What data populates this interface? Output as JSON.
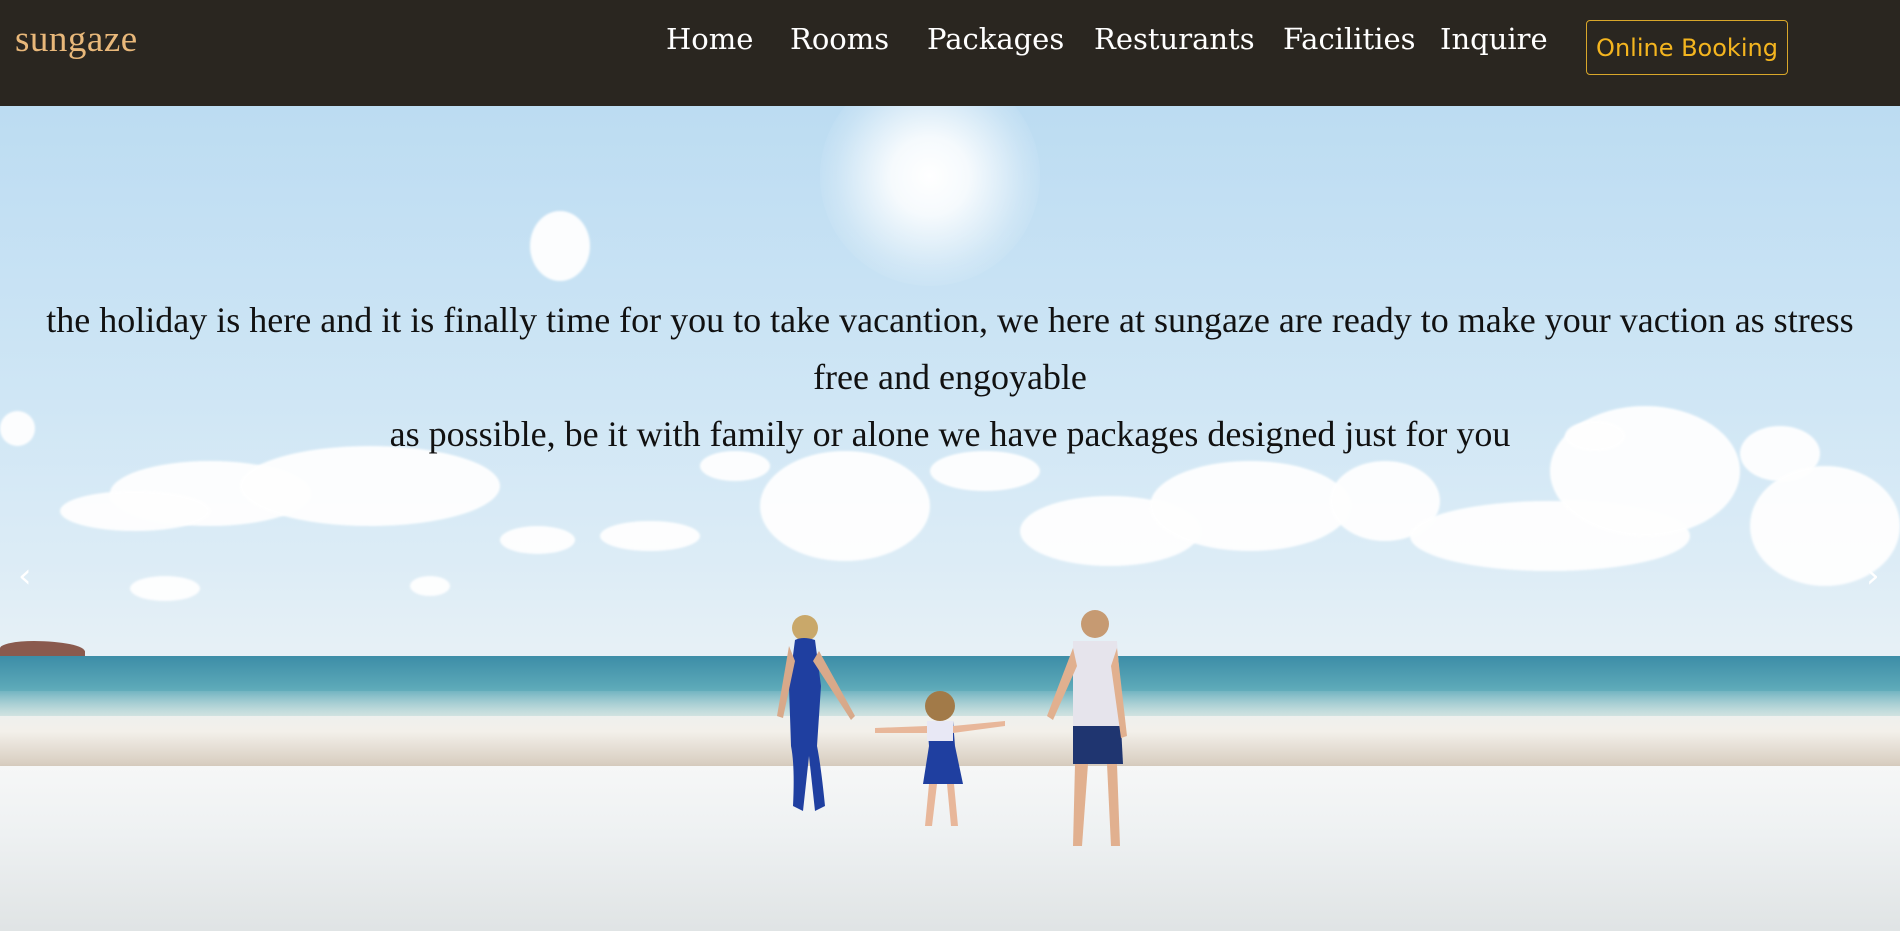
{
  "brand": {
    "name": "sungaze"
  },
  "nav": {
    "items": [
      "Home",
      "Rooms",
      "Packages",
      "Resturants",
      "Facilities",
      "Inquire"
    ],
    "booking_label": "Online Booking"
  },
  "hero": {
    "line1": "the holiday is here and it is finally time for you to take vacantion, we here at sungaze are ready to make your vaction as stress free and engoyable",
    "line2": "as possible, be it with family or alone we have packages designed just for you",
    "prev_arrow": "‹",
    "next_arrow": "›"
  },
  "colors": {
    "navbar_bg": "#2a2620",
    "brand": "#e9b87a",
    "booking_accent": "#f4b51f"
  }
}
